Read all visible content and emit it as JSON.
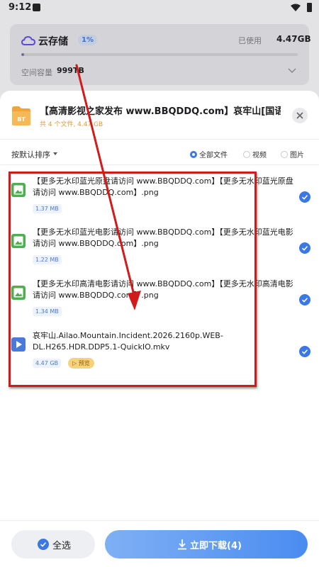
{
  "status_bar": {
    "time": "9:12"
  },
  "storage": {
    "title": "云存储",
    "badge": "1%",
    "used_label": "已使用",
    "used_value": "4.47GB",
    "used_fraction": 0.01,
    "capacity_label": "空间容量",
    "capacity_value": "999TB"
  },
  "sheet": {
    "title": "【高清影视之家发布 www.BBQDDQ.com】哀牢山[国语配...",
    "subtitle": "共 4 个文件, 4.47 GB",
    "folder_icon_text": "BT"
  },
  "toolbar": {
    "sort_label": "按默认排序",
    "filters": [
      {
        "label": "全部文件",
        "selected": true
      },
      {
        "label": "视频",
        "selected": false
      },
      {
        "label": "图片",
        "selected": false
      }
    ]
  },
  "files": [
    {
      "name": "【更多无水印蓝光原盘请访问 www.BBQDDQ.com】【更多无水印蓝光原盘请访问 www.BBQDDQ.com】.png",
      "size": "1.37 MB",
      "type": "image",
      "checked": true
    },
    {
      "name": "【更多无水印蓝光电影请访问 www.BBQDDQ.com】【更多无水印蓝光电影请访问 www.BBQDDQ.com】.png",
      "size": "1.22 MB",
      "type": "image",
      "checked": true
    },
    {
      "name": "【更多无水印高清电影请访问 www.BBQDDQ.com】【更多无水印高清电影请访问 www.BBQDDQ.com】.png",
      "size": "1.34 MB",
      "type": "image",
      "checked": true
    },
    {
      "name": "哀牢山.Ailao.Mountain.Incident.2026.2160p.WEB-DL.H265.HDR.DDP5.1-QuickIO.mkv",
      "size": "4.47 GB",
      "type": "video",
      "checked": true,
      "preview_label": "▷ 预览"
    }
  ],
  "bottom": {
    "select_all_label": "全选",
    "download_label": "立即下载(4)"
  },
  "colors": {
    "accent": "#3a78e6",
    "annotation": "#d11a1a",
    "image_icon": "#4caf50",
    "video_icon": "#4a7ad9",
    "folder": "#f2a43a"
  }
}
